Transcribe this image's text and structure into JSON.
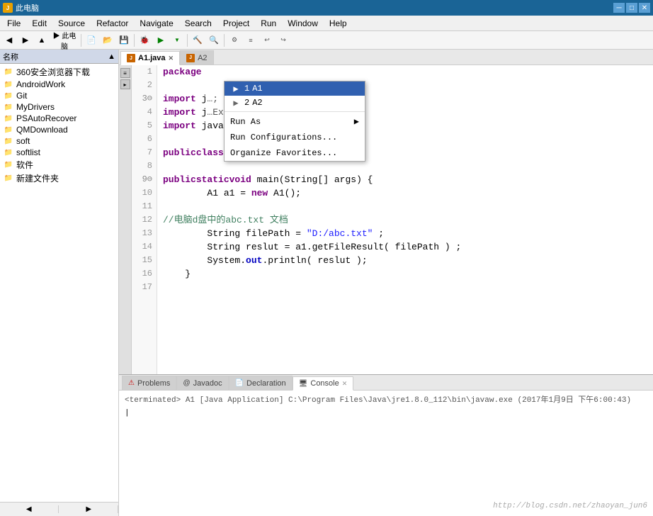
{
  "titlebar": {
    "icon": "J",
    "text": "此电脑",
    "controls": {
      "minimize": "─",
      "maximize": "□",
      "close": "✕"
    }
  },
  "menubar": {
    "items": [
      "File",
      "Edit",
      "Source",
      "Refactor",
      "Navigate",
      "Search",
      "Project",
      "Run",
      "Window",
      "Help"
    ]
  },
  "sidebar": {
    "header": "名称",
    "items": [
      {
        "label": "360安全浏览器下载",
        "type": "folder",
        "indent": 0
      },
      {
        "label": "AndroidWork",
        "type": "folder",
        "indent": 0
      },
      {
        "label": "Git",
        "type": "folder",
        "indent": 0
      },
      {
        "label": "MyDrivers",
        "type": "folder",
        "indent": 0
      },
      {
        "label": "PSAutoRecover",
        "type": "folder",
        "indent": 0
      },
      {
        "label": "QMDownload",
        "type": "folder",
        "indent": 0
      },
      {
        "label": "soft",
        "type": "folder",
        "indent": 0
      },
      {
        "label": "softlist",
        "type": "folder",
        "indent": 0
      },
      {
        "label": "软件",
        "type": "folder",
        "indent": 0
      },
      {
        "label": "新建文件夹",
        "type": "folder",
        "indent": 0
      }
    ]
  },
  "editor": {
    "tabs": [
      {
        "label": "A1.java",
        "active": true,
        "icon": "J"
      },
      {
        "label": "A2",
        "active": false,
        "icon": "J"
      }
    ],
    "lines": [
      {
        "num": 1,
        "content": "package",
        "type": "package_line"
      },
      {
        "num": 2,
        "content": ""
      },
      {
        "num": 3,
        "content": "import j",
        "type": "import_line_1",
        "arrow": true
      },
      {
        "num": 4,
        "content": "import j",
        "type": "import_line_2"
      },
      {
        "num": 5,
        "content": "import java.io.IOException;",
        "type": "import_line_3"
      },
      {
        "num": 6,
        "content": ""
      },
      {
        "num": 7,
        "content": "public class A1 {",
        "type": "class_decl"
      },
      {
        "num": 8,
        "content": ""
      },
      {
        "num": 9,
        "content": "    public static void main(String[] args) {",
        "type": "method_decl",
        "arrow": true
      },
      {
        "num": 10,
        "content": "        A1 a1 = new A1();",
        "type": "code"
      },
      {
        "num": 11,
        "content": ""
      },
      {
        "num": 12,
        "content": "        //电脑d盘中的abc.txt 文档",
        "type": "comment"
      },
      {
        "num": 13,
        "content": "        String filePath = \"D:/abc.txt\" ;",
        "type": "code"
      },
      {
        "num": 14,
        "content": "        String reslut = a1.getFileResult( filePath ) ;",
        "type": "code"
      },
      {
        "num": 15,
        "content": "        System.out.println( reslut );",
        "type": "code"
      },
      {
        "num": 16,
        "content": "    }",
        "type": "code"
      },
      {
        "num": 17,
        "content": "",
        "type": "code"
      }
    ]
  },
  "dropdown": {
    "items": [
      {
        "num": "1",
        "label": "A1",
        "selected": true
      },
      {
        "num": "2",
        "label": "A2",
        "selected": false
      }
    ],
    "menu_items": [
      {
        "label": "Run As",
        "has_arrow": true
      },
      {
        "label": "Run Configurations...",
        "has_arrow": false
      },
      {
        "label": "Organize Favorites...",
        "has_arrow": false
      }
    ]
  },
  "bottom_panel": {
    "tabs": [
      {
        "label": "Problems",
        "active": false
      },
      {
        "label": "Javadoc",
        "active": false
      },
      {
        "label": "Declaration",
        "active": false
      },
      {
        "label": "Console",
        "active": true
      }
    ],
    "console_text": "<terminated> A1 [Java Application] C:\\Program Files\\Java\\jre1.8.0_112\\bin\\javaw.exe (2017年1月9日 下午6:00:43)"
  },
  "watermark": "http://blog.csdn.net/zhaoyan_jun6"
}
